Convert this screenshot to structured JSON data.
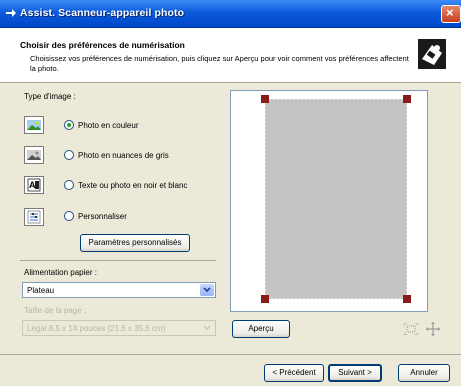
{
  "window": {
    "title": "Assist. Scanneur-appareil photo"
  },
  "header": {
    "title": "Choisir des préférences de numérisation",
    "description": "Choisissez vos préférences de numérisation, puis cliquez sur Aperçu pour voir comment vos préférences affectent la photo."
  },
  "image_type": {
    "label": "Type d'image :",
    "options": [
      {
        "label": "Photo en couleur",
        "icon": "color-photo-icon",
        "selected": true
      },
      {
        "label": "Photo en nuances de gris",
        "icon": "grayscale-photo-icon",
        "selected": false
      },
      {
        "label": "Texte ou photo en noir et blanc",
        "icon": "bw-text-icon",
        "selected": false
      },
      {
        "label": "Personnaliser",
        "icon": "custom-settings-icon",
        "selected": false
      }
    ],
    "custom_button": "Paramètres personnalisés"
  },
  "paper": {
    "label": "Alimentation papier :",
    "value": "Plateau",
    "size_label": "Taille de la page :",
    "size_value": "Légal 8,5 x 14 pouces (21,6 x 35,6 cm)"
  },
  "preview": {
    "button": "Aperçu"
  },
  "footer": {
    "back": "< Précédent",
    "next": "Suivant >",
    "cancel": "Annuler"
  },
  "colors": {
    "titlebar": "#0a5bdc",
    "preview_area": "#c0c0c0",
    "handles": "#8b1a1a"
  }
}
